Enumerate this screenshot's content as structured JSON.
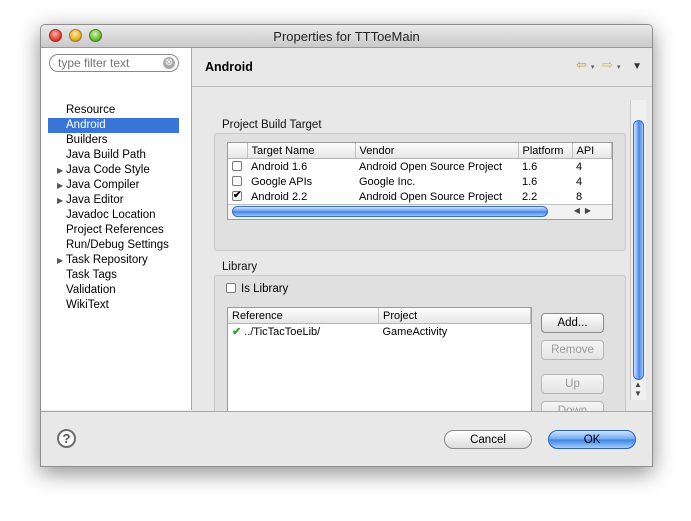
{
  "window": {
    "title": "Properties for TTToeMain"
  },
  "filter": {
    "placeholder": "type filter text",
    "clear_glyph": "⊗"
  },
  "tree": [
    {
      "label": "Resource",
      "expandable": false
    },
    {
      "label": "Android",
      "expandable": false,
      "selected": true
    },
    {
      "label": "Builders",
      "expandable": false
    },
    {
      "label": "Java Build Path",
      "expandable": false
    },
    {
      "label": "Java Code Style",
      "expandable": true
    },
    {
      "label": "Java Compiler",
      "expandable": true
    },
    {
      "label": "Java Editor",
      "expandable": true
    },
    {
      "label": "Javadoc Location",
      "expandable": false
    },
    {
      "label": "Project References",
      "expandable": false
    },
    {
      "label": "Run/Debug Settings",
      "expandable": false
    },
    {
      "label": "Task Repository",
      "expandable": true
    },
    {
      "label": "Task Tags",
      "expandable": false
    },
    {
      "label": "Validation",
      "expandable": false
    },
    {
      "label": "WikiText",
      "expandable": false
    }
  ],
  "page": {
    "title": "Android",
    "nav": {
      "back": "⇦",
      "forward": "⇨",
      "dropdown": "▾",
      "menu": "▼"
    }
  },
  "build_target": {
    "label": "Project Build Target",
    "columns": [
      "Target Name",
      "Vendor",
      "Platform",
      "API"
    ],
    "rows": [
      {
        "name": "Android 1.6",
        "vendor": "Android Open Source Project",
        "platform": "1.6",
        "api": "4",
        "checked": false
      },
      {
        "name": "Google APIs",
        "vendor": "Google Inc.",
        "platform": "1.6",
        "api": "4",
        "checked": false
      },
      {
        "name": "Android 2.2",
        "vendor": "Android Open Source Project",
        "platform": "2.2",
        "api": "8",
        "checked": true
      }
    ]
  },
  "library": {
    "label": "Library",
    "is_library_label": "Is Library",
    "is_library_checked": false,
    "columns": [
      "Reference",
      "Project"
    ],
    "rows": [
      {
        "reference": "../TicTacToeLib/",
        "project": "GameActivity",
        "status": "ok"
      }
    ],
    "buttons": {
      "add": "Add...",
      "remove": "Remove",
      "up": "Up",
      "down": "Down"
    }
  },
  "footer": {
    "help_glyph": "?",
    "cancel": "Cancel",
    "ok": "OK"
  },
  "colors": {
    "selection": "#3875d7",
    "ok_check": "#2aa02a",
    "accent_blue": "#3b82e6"
  }
}
